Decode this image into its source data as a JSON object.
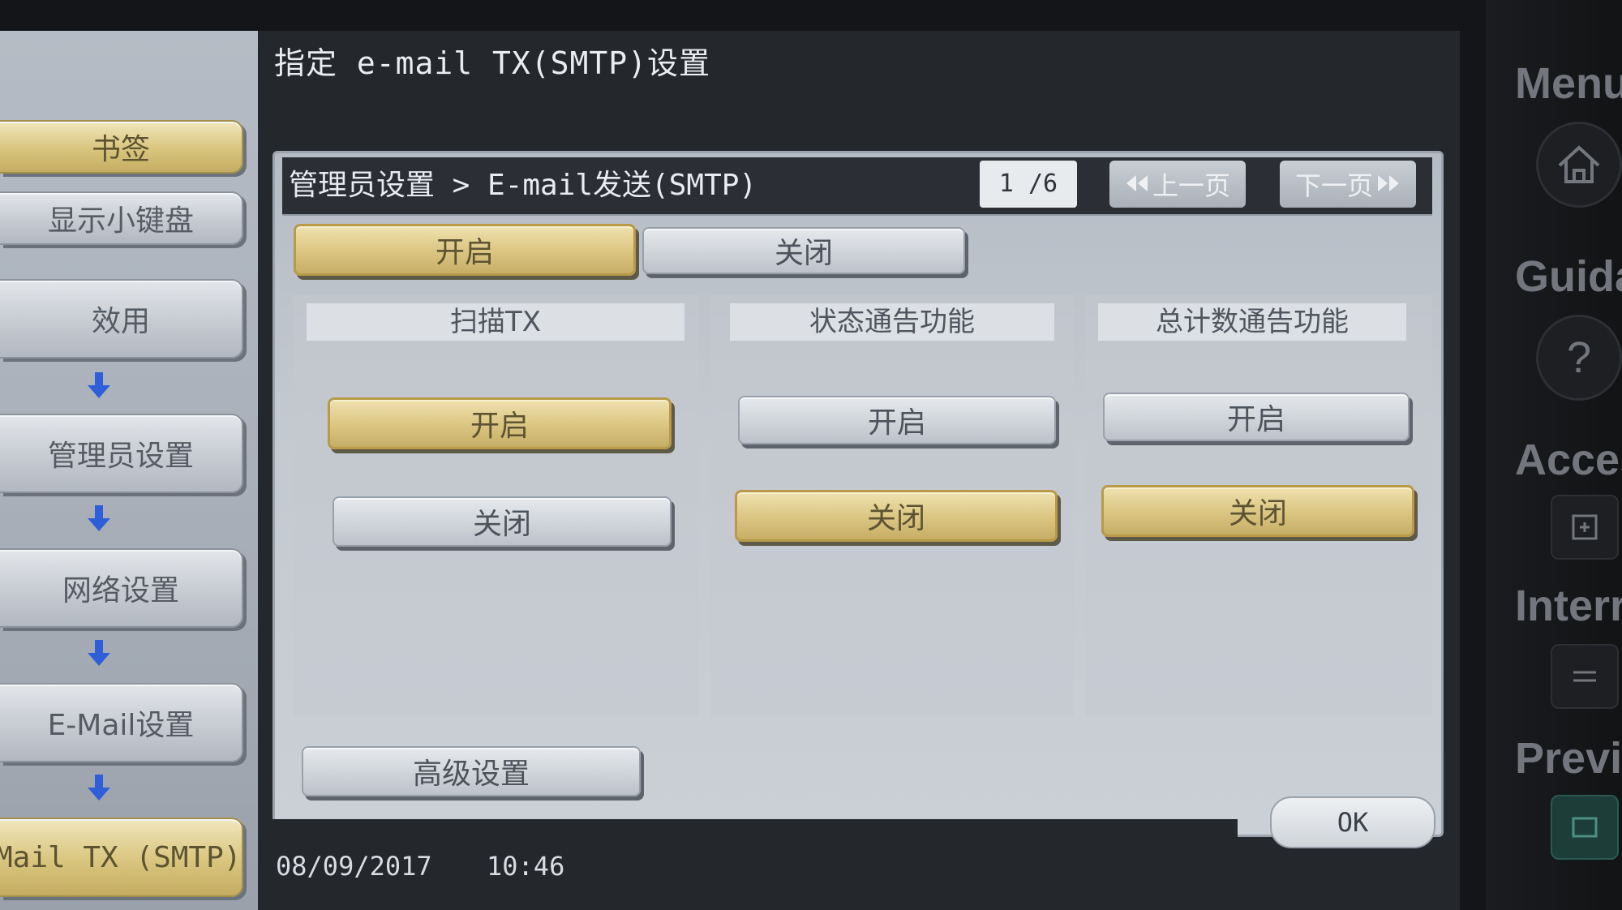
{
  "screen": {
    "title": "指定 e-mail TX(SMTP)设置",
    "breadcrumb": "管理员设置 > E-mail发送(SMTP)",
    "page_indicator": "1 /6",
    "prev_page": "上一页",
    "next_page": "下一页"
  },
  "sidebar": {
    "items": [
      {
        "label": "书签",
        "highlighted": true
      },
      {
        "label": "显示小键盘",
        "highlighted": false
      },
      {
        "label": "效用",
        "highlighted": false
      },
      {
        "label": "管理员设置",
        "highlighted": false
      },
      {
        "label": "网络设置",
        "highlighted": false
      },
      {
        "label": "E-Mail设置",
        "highlighted": false
      },
      {
        "label": "Mail TX (SMTP)",
        "highlighted": true
      }
    ]
  },
  "main": {
    "master_toggle": {
      "on_label": "开启",
      "off_label": "关闭",
      "selected": "on"
    },
    "columns": [
      {
        "header": "扫描TX",
        "on_label": "开启",
        "off_label": "关闭",
        "selected": "on"
      },
      {
        "header": "状态通告功能",
        "on_label": "开启",
        "off_label": "关闭",
        "selected": "off"
      },
      {
        "header": "总计数通告功能",
        "on_label": "开启",
        "off_label": "关闭",
        "selected": "off"
      }
    ],
    "advanced_label": "高级设置"
  },
  "status": {
    "date": "08/09/2017",
    "time": "10:46",
    "ok_label": "OK"
  },
  "hardware_panel": {
    "labels": [
      "Menu",
      "Guidan",
      "Acces",
      "Interr",
      "Previ"
    ],
    "icons": [
      "home-icon",
      "help-icon",
      "access-icon",
      "interrupt-icon",
      "preview-icon"
    ]
  },
  "colors": {
    "selected_gold": "#dcc784",
    "button_gray": "#cfd4da",
    "panel": "#c3c9d0",
    "dark_bar": "#2b2e34"
  }
}
